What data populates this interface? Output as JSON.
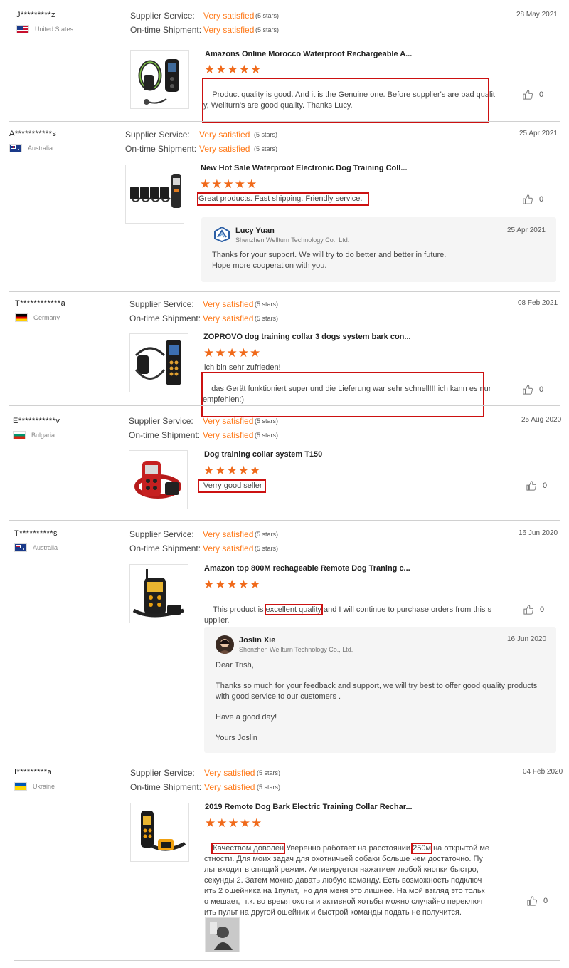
{
  "common": {
    "supplier_label": "Supplier Service:",
    "shipment_label": "On-time Shipment:",
    "satisfied": "Very satisfied",
    "stars_text": "(5 stars)",
    "star_glyphs": "★★★★★",
    "like_count": "0"
  },
  "reviews": [
    {
      "user": "J*********z",
      "country": "United States",
      "date": "28 May 2021",
      "product": "Amazons Online Morocco Waterproof Rechargeable A...",
      "text_line1": "Product quality is good. And it is the Genuine one. Before supplier's are bad qualit",
      "text_line2": "y, Wellturn's are good quality. Thanks Lucy."
    },
    {
      "user": "A***********s",
      "country": "Australia",
      "date": "25 Apr 2021",
      "product": "New Hot Sale Waterproof Electronic Dog Training Coll...",
      "text": "Great products. Fast shipping. Friendly service.",
      "reply": {
        "name": "Lucy Yuan",
        "company": "Shenzhen Wellturn Technology Co., Ltd.",
        "date": "25 Apr 2021",
        "text": "Thanks for your support. We will try to do better and better in future.\nHope more cooperation with you."
      }
    },
    {
      "user": "T************a",
      "country": "Germany",
      "date": "08 Feb 2021",
      "product": "ZOPROVO dog training collar 3 dogs system bark con...",
      "text_plain": "ich bin sehr zufrieden!",
      "text_line1": "das Gerät funktioniert super und die Lieferung war sehr schnell!!! ich kann es nur",
      "text_line2": "empfehlen:)"
    },
    {
      "user": "E***********v",
      "country": "Bulgaria",
      "date": "25 Aug 2020",
      "product": "Dog training collar system T150",
      "text": "Verry good seller"
    },
    {
      "user": "T**********s",
      "country": "Australia",
      "date": "16 Jun 2020",
      "product": "Amazon top 800M rechageable Remote Dog Traning c...",
      "text_pre": "This product is ",
      "text_hl": "excellent quality",
      "text_post": " and I will continue to purchase orders from this s",
      "text_line2": "upplier.",
      "reply": {
        "name": "Joslin Xie",
        "company": "Shenzhen Wellturn Technology Co., Ltd.",
        "date": "16 Jun 2020",
        "text": "Dear Trish,\n\nThanks so much for your feedback and support, we will try best to offer good quality products\nwith good service to our customers .\n\nHave a good day!\n\nYours Joslin"
      }
    },
    {
      "user": "I*********a",
      "country": "Ukraine",
      "date": "04 Feb 2020",
      "product": "2019 Remote Dog Bark Electric Training Collar Rechar...",
      "text_hl1": "Качеством доволен",
      "text_mid": " Уверенно работает на расстоянии ",
      "text_hl2": "250м",
      "text_post": " на открытой ме",
      "text_rest": "стности. Для моих задач для охотничьей собаки больше чем достаточно. Пу\nльт входит в спящий режим. Активируется нажатием любой кнопки быстро,\nсекунды 2. Затем можно давать любую команду. Есть возможность подключ\nить 2 ошейника на 1пульт,  но для меня это лишнее. На мой взгляд это тольк\nо мешает,  т.к. во время охоты и активной хотьбы можно случайно переключ\nить пульт на другой ошейник и быстрой команды подать не получится."
    }
  ]
}
